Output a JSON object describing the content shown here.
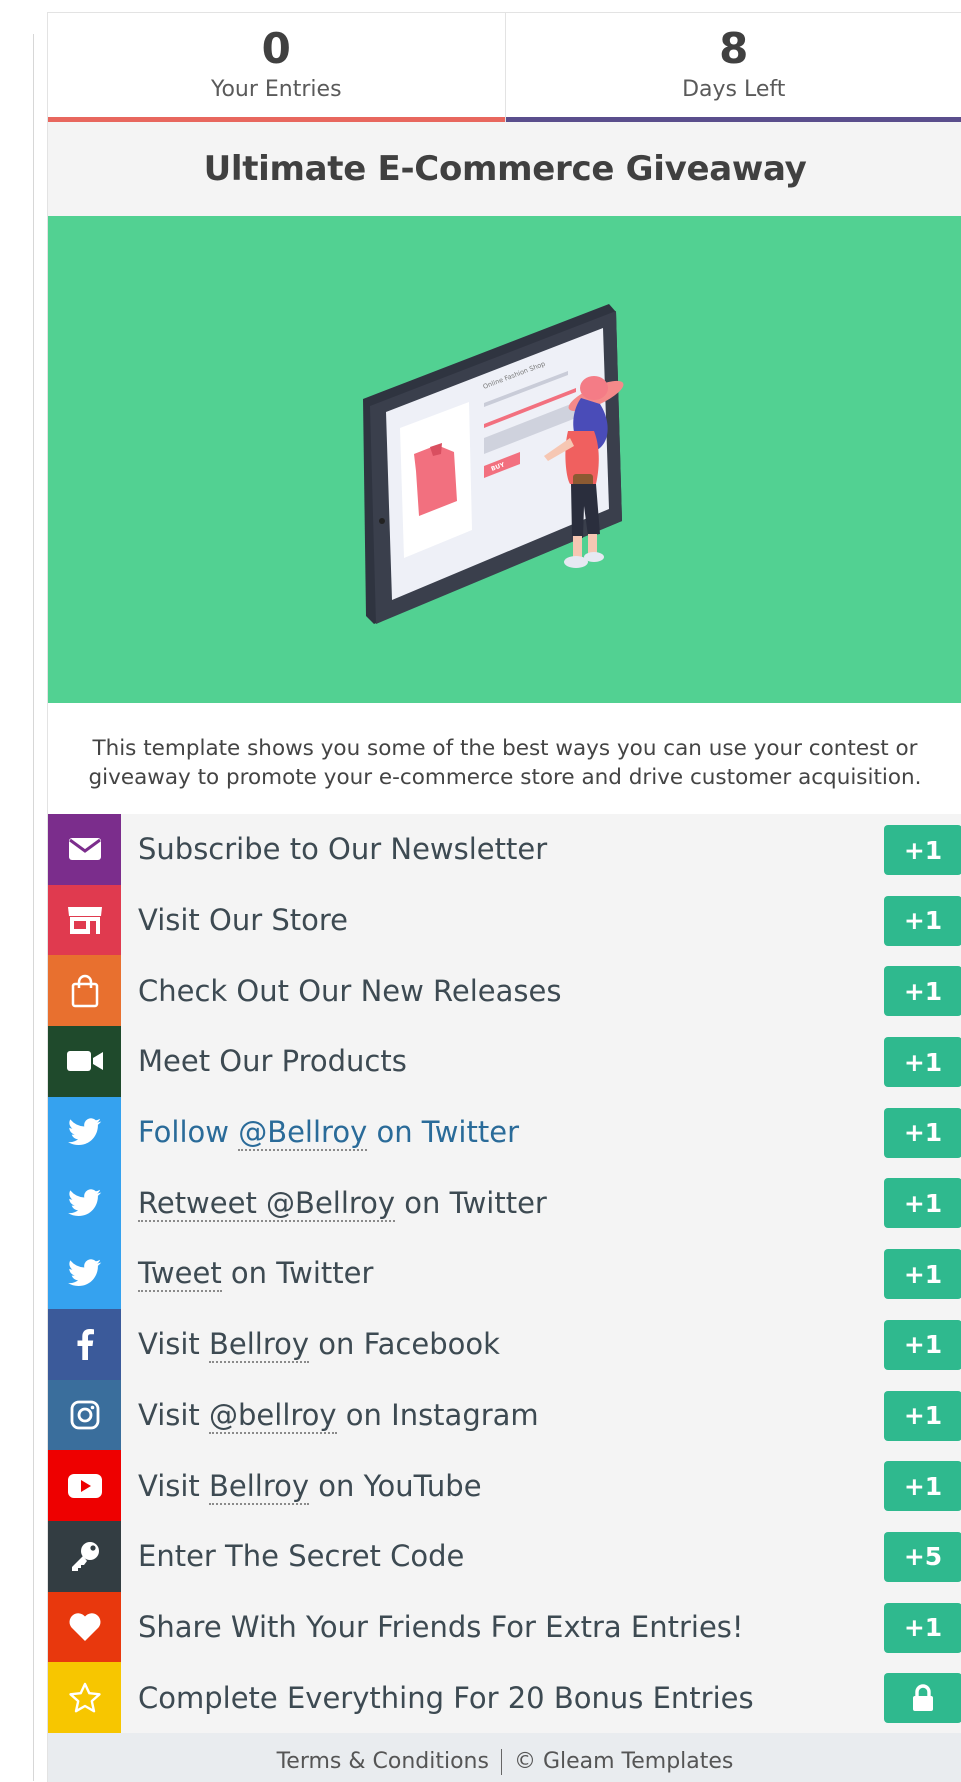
{
  "stats": {
    "entries": {
      "value": "0",
      "label": "Your Entries"
    },
    "days": {
      "value": "8",
      "label": "Days Left"
    }
  },
  "campaign": {
    "title": "Ultimate E-Commerce Giveaway",
    "description": "This template shows you some of the best ways you can use your contest or giveaway to promote your e-commerce store and drive customer acquisition.",
    "hero_screen_heading": "Online Fashion Shop",
    "hero_buy_label": "BUY"
  },
  "entries": [
    {
      "icon": "envelope-icon",
      "color": "#7b2d8c",
      "pre": "Subscribe to Our Newsletter",
      "link": "",
      "post": "",
      "points": "+1"
    },
    {
      "icon": "store-icon",
      "color": "#e03a4f",
      "pre": "Visit Our Store",
      "link": "",
      "post": "",
      "points": "+1"
    },
    {
      "icon": "shopping-bag-icon",
      "color": "#e8702f",
      "pre": "Check Out Our New Releases",
      "link": "",
      "post": "",
      "points": "+1"
    },
    {
      "icon": "video-camera-icon",
      "color": "#1f4a2c",
      "pre": "Meet Our Products",
      "link": "",
      "post": "",
      "points": "+1"
    },
    {
      "icon": "twitter-icon",
      "color": "#35a2ef",
      "pre": "Follow ",
      "link": "@Bellroy",
      "post": " on Twitter",
      "points": "+1"
    },
    {
      "icon": "twitter-icon",
      "color": "#35a2ef",
      "pre": "",
      "link": "Retweet @Bellroy",
      "post": " on Twitter",
      "points": "+1"
    },
    {
      "icon": "twitter-icon",
      "color": "#35a2ef",
      "pre": "",
      "link": "Tweet",
      "post": " on Twitter",
      "points": "+1"
    },
    {
      "icon": "facebook-icon",
      "color": "#3b5a9a",
      "pre": "Visit ",
      "link": "Bellroy",
      "post": " on Facebook",
      "points": "+1"
    },
    {
      "icon": "instagram-icon",
      "color": "#3a6e9c",
      "pre": "Visit ",
      "link": "@bellroy",
      "post": " on Instagram",
      "points": "+1"
    },
    {
      "icon": "youtube-icon",
      "color": "#ee0000",
      "pre": "Visit ",
      "link": "Bellroy",
      "post": " on YouTube",
      "points": "+1"
    },
    {
      "icon": "key-icon",
      "color": "#333d42",
      "pre": "Enter The Secret Code",
      "link": "",
      "post": "",
      "points": "+5"
    },
    {
      "icon": "heart-icon",
      "color": "#e8380d",
      "pre": "Share With Your Friends For Extra Entries!",
      "link": "",
      "post": "",
      "points": "+1"
    },
    {
      "icon": "star-icon",
      "color": "#f7c600",
      "pre": "Complete Everything For 20 Bonus Entries",
      "link": "",
      "post": "",
      "points": "lock-icon"
    }
  ],
  "footer": {
    "terms": "Terms & Conditions",
    "credit": "© Gleam Templates"
  }
}
